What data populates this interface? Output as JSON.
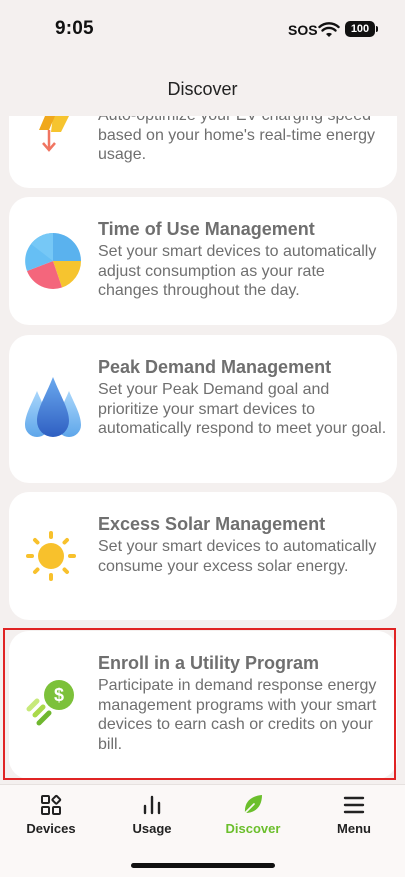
{
  "status": {
    "time": "9:05",
    "sos": "SOS",
    "battery": "100"
  },
  "header": {
    "title": "Discover"
  },
  "cards": [
    {
      "title": "",
      "description": "Auto-optimize your EV charging speed based on your home's real-time energy usage.",
      "icon": "ev-charging-icon"
    },
    {
      "title": "Time of Use Management",
      "description": "Set your smart devices to automatically adjust consumption as your rate changes throughout the day.",
      "icon": "pie-chart-icon"
    },
    {
      "title": "Peak Demand Management",
      "description": "Set your Peak Demand goal and prioritize your smart devices to automatically respond to meet your goal.",
      "icon": "peaks-icon"
    },
    {
      "title": "Excess Solar Management",
      "description": "Set your smart devices to automatically consume your excess solar energy.",
      "icon": "sun-icon"
    },
    {
      "title": "Enroll in a Utility Program",
      "description": "Participate in demand response energy management programs with your smart devices to earn cash or credits on your bill.",
      "icon": "dollar-coin-icon"
    }
  ],
  "tabs": [
    {
      "label": "Devices",
      "icon": "devices-icon"
    },
    {
      "label": "Usage",
      "icon": "bar-chart-icon"
    },
    {
      "label": "Discover",
      "icon": "leaf-icon"
    },
    {
      "label": "Menu",
      "icon": "hamburger-menu-icon"
    }
  ],
  "colors": {
    "accent": "#6bbf2c",
    "highlight_border": "#e02424",
    "background": "#f4f0ef"
  }
}
